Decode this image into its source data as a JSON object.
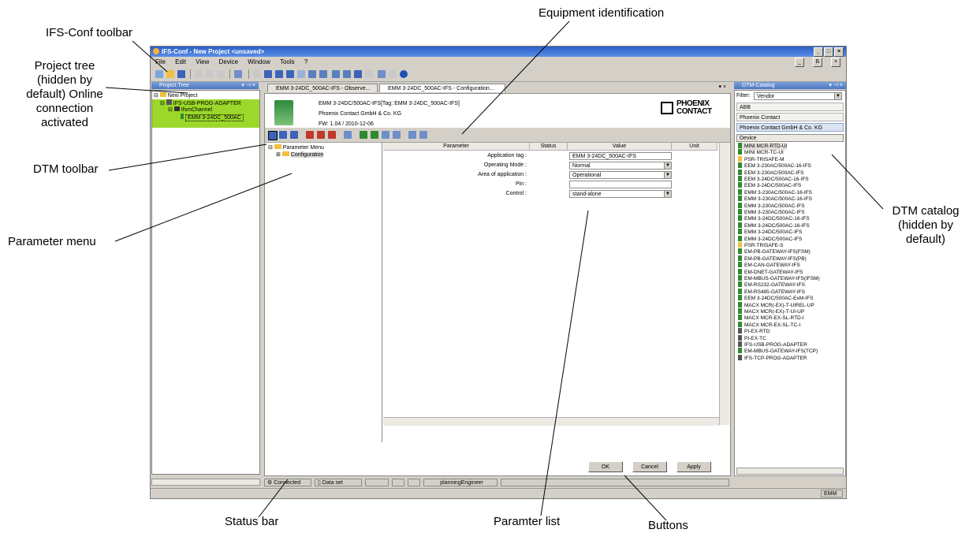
{
  "annotations": {
    "equipment_identification": "Equipment identification",
    "ifs_conf_toolbar": "IFS-Conf toolbar",
    "project_tree_1": "Project tree",
    "project_tree_2": "(hidden by",
    "project_tree_3": "default) Online",
    "project_tree_4": "connection",
    "project_tree_5": "activated",
    "dtm_toolbar": "DTM toolbar",
    "parameter_menu": "Parameter menu",
    "dtm_catalog_1": "DTM catalog",
    "dtm_catalog_2": "(hidden by",
    "dtm_catalog_3": "default)",
    "status_bar": "Status bar",
    "paramter_list": "Paramter list",
    "buttons": "Buttons"
  },
  "window": {
    "title": "IFS-Conf - New Project  <unsaved>",
    "controls": [
      "_",
      "□",
      "×"
    ],
    "inner_controls": [
      "_",
      "Б",
      "×"
    ],
    "menu": [
      "File",
      "Edit",
      "View",
      "Device",
      "Window",
      "Tools",
      "?"
    ]
  },
  "project_tree": {
    "header": "Project Tree",
    "items": [
      "New Project",
      "IFS-USB-PROG-ADAPTER",
      "IfsmChannel",
      "EMM 3-24DC_500AC"
    ]
  },
  "tabs": [
    "EMM 3-24DC_500AC-IFS - Observe...",
    "EMM 3-24DC_500AC-IFS - Configuration..."
  ],
  "device": {
    "line1": "EMM 3-24DC/500AC-IFS[Tag: EMM 3-24DC_500AC-IFS]",
    "line2": "Phoenix Contact GmbH & Co. KG",
    "line3": "FW: 1.04 / 2010-12-06",
    "logo_top": "PHOENIX",
    "logo_bottom": "CONTACT"
  },
  "parameter_menu": {
    "root": "Parameter Menu",
    "child": "Configuration"
  },
  "parameter_table": {
    "columns": [
      "Parameter",
      "Status",
      "Value",
      "Unit"
    ],
    "rows": [
      {
        "label": "Application tag :",
        "value": "EMM 3-24DC_500AC-IFS",
        "dropdown": false
      },
      {
        "label": "Operating Mode :",
        "value": "Normal",
        "dropdown": true
      },
      {
        "label": "Area of application :",
        "value": "Operational",
        "dropdown": true
      },
      {
        "label": "Pin :",
        "value": "",
        "dropdown": false
      },
      {
        "label": "Control :",
        "value": "stand-alone",
        "dropdown": true
      }
    ]
  },
  "buttons": {
    "ok": "OK",
    "cancel": "Cancel",
    "apply": "Apply"
  },
  "status_bar": {
    "connection": "Connected",
    "data_set": "Data set",
    "user": "planningEngineer",
    "right": "EMM"
  },
  "catalog": {
    "header": "DTM-Catalog",
    "filter_label": "Filter:",
    "filter_value": "Vendor",
    "vendors": [
      "ABB",
      "Phoenix Contact",
      "Phoenix Contact GmbH & Co. KG"
    ],
    "device_column": "Device",
    "devices": [
      "MINI MCR-RTD-UI",
      "MINI MCR-TC-UI",
      "PSR-TRISAFE-M",
      "EEM 3-230AC/500AC-16-IFS",
      "EEM 3-230AC/500AC-IFS",
      "EEM 3-24DC/500AC-16-IFS",
      "EEM 3-24DC/500AC-IFS",
      "EMM 3-230AC/500AC-16-IFS",
      "EMM 3-230AC/500AC-16-IFS",
      "EMM 3-230AC/500AC-IFS",
      "EMM 3-230AC/500AC-IFS",
      "EMM 3-24DC/500AC-16-IFS",
      "EMM 3-24DC/500AC-16-IFS",
      "EMM 3-24DC/500AC-IFS",
      "EMM 3-24DC/500AC-IFS",
      "PSR-TRISAFE-S",
      "EM-PB-GATEWAY-IFS(FSM)",
      "EM-PB-GATEWAY-IFS(PB)",
      "EM-CAN-GATEWAY-IFS",
      "EM-DNET-GATEWAY-IFS",
      "EM-MBUS-GATEWAY-IFS(IFSM)",
      "EM-RS232-GATEWAY-IFS",
      "EM-RS485-GATEWAY-IFS",
      "EEM 3-24DC/500AC-ExM-IFS",
      "MACX MCR(-EX)-T-UIREL-UP",
      "MACX MCR(-EX)-T-UI-UP",
      "MACX MCR-EX-SL-RTD-I",
      "MACX MCR-EX-SL-TC-I",
      "PI-EX-RTD",
      "PI-EX-TC",
      "IFS-USB-PROG-ADAPTER",
      "EM-MBUS-GATEWAY-IFS(TCP)",
      "IFS-TCP-PROG-ADAPTER"
    ]
  },
  "colors": {
    "title_blue": "#2a5fc6",
    "tree_highlight": "#9bd82a",
    "chrome": "#d4d0c8"
  }
}
